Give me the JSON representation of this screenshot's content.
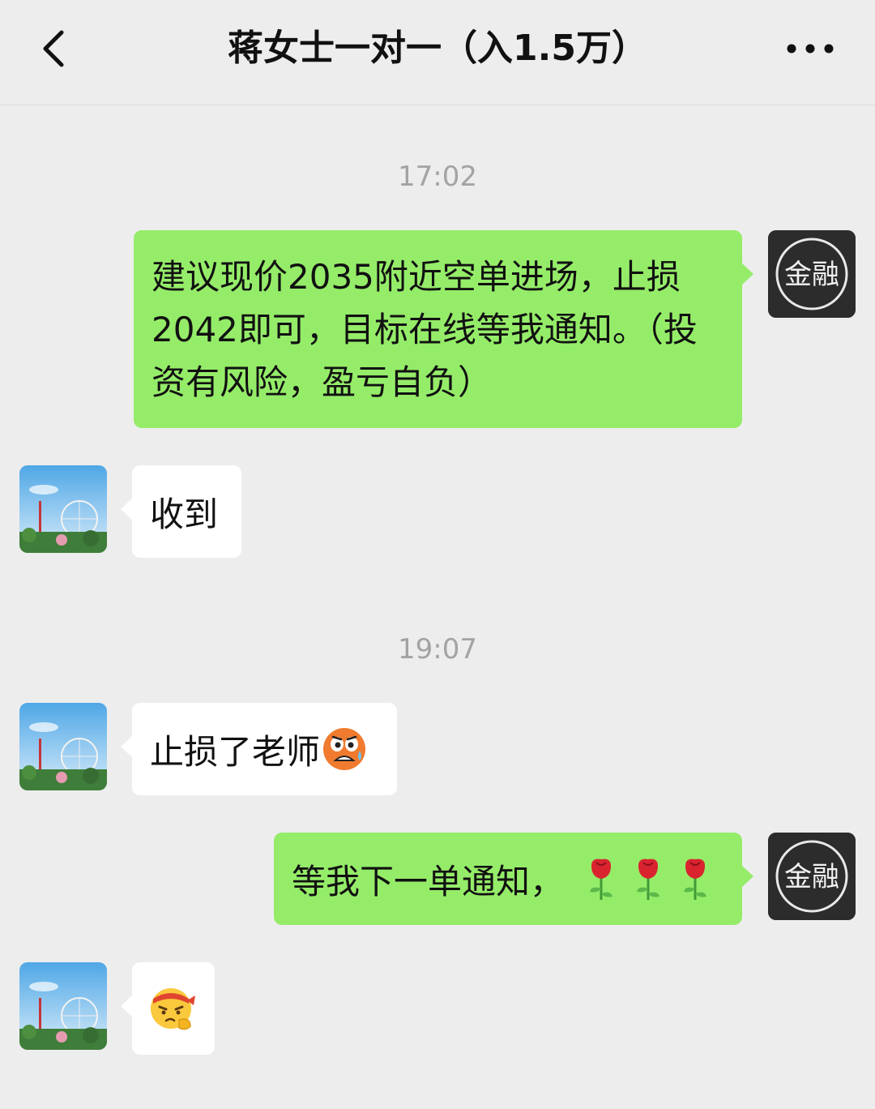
{
  "header": {
    "title": "蒋女士一对一（入1.5万）",
    "back_icon": "chevron-left-icon",
    "more_icon": "more-dots-icon"
  },
  "messages": {
    "time1": "17:02",
    "m1": "建议现价2035附近空单进场，止损2042即可，目标在线等我通知。（投资有风险，盈亏自负）",
    "m2": "收到",
    "time2": "19:07",
    "m3": "止损了老师",
    "m3_emoji": "scared-face-emoji",
    "m4": "等我下一单通知，",
    "m4_emoji": "rose-icon",
    "m5_emoji": "determined-face-emoji"
  },
  "sender_avatar": {
    "label": "金融"
  },
  "colors": {
    "outgoing": "#95ec69",
    "incoming": "#ffffff",
    "background": "#ededed",
    "timestamp": "#a3a3a3"
  }
}
